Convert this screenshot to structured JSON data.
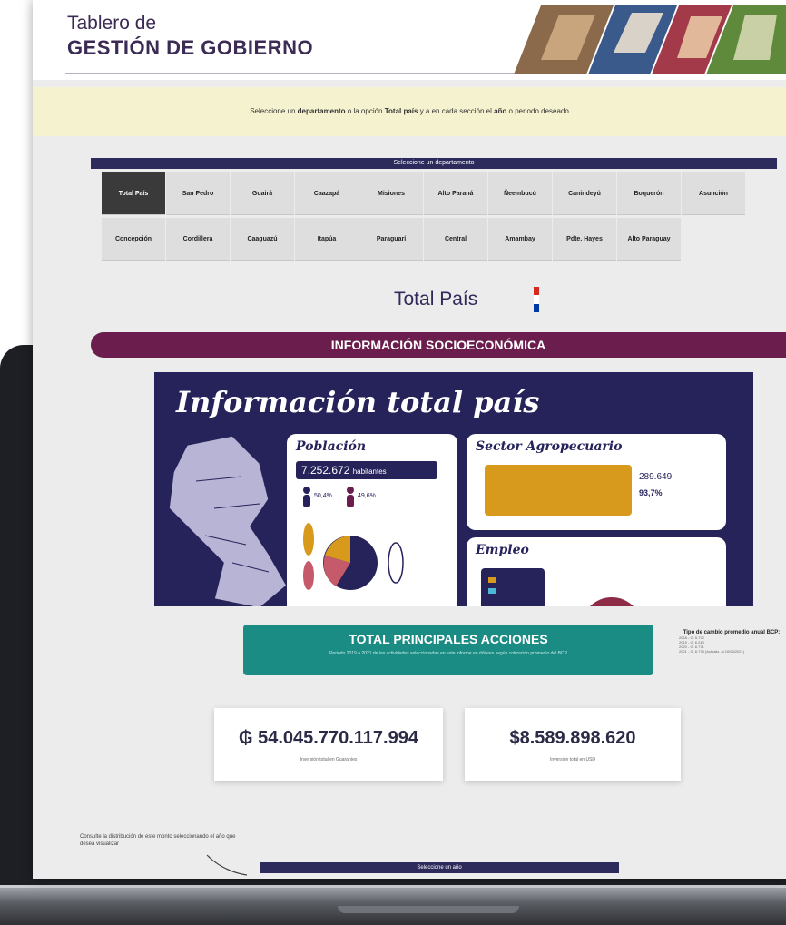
{
  "header": {
    "title_line1": "Tablero de",
    "title_line2": "GESTIÓN DE GOBIERNO"
  },
  "notice": {
    "part1": "Seleccione un ",
    "bold1": "departamento",
    "part2": " o la opción ",
    "bold2": "Total país",
    "part3": " y a en cada sección el ",
    "bold3": "año",
    "part4": " o periodo deseado"
  },
  "departments": {
    "header": "Seleccione un departamento",
    "row1": [
      "Total País",
      "San Pedro",
      "Guairá",
      "Caazapá",
      "Misiones",
      "Alto Paraná",
      "Ñeembucú",
      "Canindeyú",
      "Boquerón",
      "Asunción"
    ],
    "row2": [
      "Concepción",
      "Cordillera",
      "Caaguazú",
      "Itapúa",
      "Paraguarí",
      "Central",
      "Amambay",
      "Pdte. Hayes",
      "Alto Paraguay"
    ],
    "active": "Total País"
  },
  "selection_title": "Total País",
  "section_band": "INFORMACIÓN SOCIOECONÓMICA",
  "infographic": {
    "title": "Información total país",
    "poblacion": {
      "title": "Población",
      "value": "7.252.672",
      "unit": "habitantes",
      "pct_a": "50,4%",
      "pct_b": "49,6%"
    },
    "agro": {
      "title": "Sector Agropecuario",
      "stat1": "289.649",
      "stat2": "93,7%"
    },
    "empleo": {
      "title": "Empleo"
    }
  },
  "acciones": {
    "title": "TOTAL PRINCIPALES ACCIONES",
    "subtitle": "Periodo 2019 a 2021 de las actividades seleccionadas en este informe en dólares según cotización promedio del BCP"
  },
  "tipo_cambio": {
    "title": "Tipo de cambio promedio anual BCP:",
    "lines": [
      "2018 - G. 5.732",
      "2019 - G. 6.240",
      "2020 - G. 6.771",
      "2021 - G. 6.775 (Actualiz. al 10/06/2021)"
    ]
  },
  "stats": {
    "pyg_value": "₲ 54.045.770.117.994",
    "pyg_label": "Inversión total en Guaraníes",
    "usd_value": "$8.589.898.620",
    "usd_label": "Inversión total en USD"
  },
  "consulte_text": "Consulte la distribución de este monto seleccionando el año que desea visualizar",
  "year_bar": "Seleccione un año",
  "colors": {
    "navy": "#2d2a5c",
    "maroon": "#6b1e4d",
    "teal": "#1b8c84",
    "notice_bg": "#f5f2cf",
    "agro_gold": "#d79a1c"
  }
}
